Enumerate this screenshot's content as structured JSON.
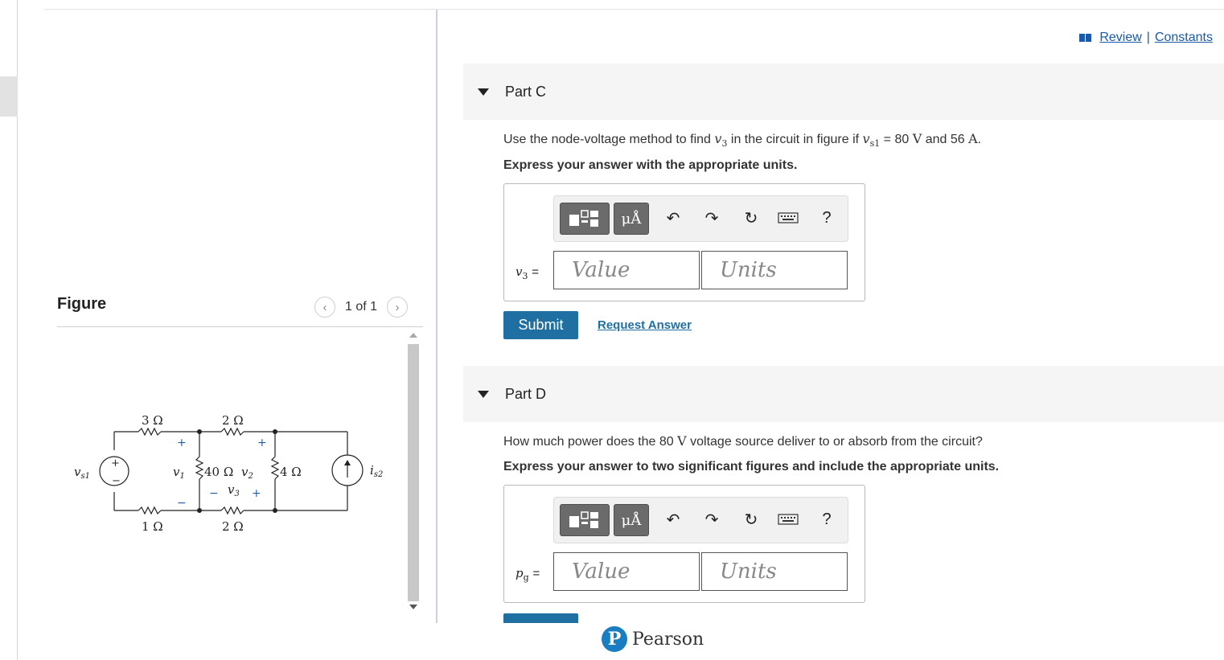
{
  "header": {
    "review_label": "Review",
    "separator": "|",
    "constants_label": "Constants"
  },
  "figure": {
    "title": "Figure",
    "pager_count": "1 of 1",
    "circuit_labels": {
      "r1": "3 Ω",
      "r2": "2 Ω",
      "r3": "40 Ω",
      "r4": "4 Ω",
      "r5": "1 Ω",
      "r6": "2 Ω",
      "v1": "v",
      "v1_sub": "1",
      "v2": "v",
      "v2_sub": "2",
      "v3": "v",
      "v3_sub": "3",
      "vs1": "v",
      "vs1_sub": "s1",
      "is2": "i",
      "is2_sub": "s2"
    }
  },
  "parts": [
    {
      "label": "Part C",
      "question_a": "Use the node-voltage method to find ",
      "question_var": "v",
      "question_var_sub": "3",
      "question_b": " in the circuit in figure if ",
      "question_var2": "v",
      "question_var2_sub": "s1",
      "question_c": " = 80 ",
      "question_unit1": "V",
      "question_d": " and 56 ",
      "question_unit2": "A",
      "question_e": ".",
      "instruction": "Express your answer with the appropriate units.",
      "var_label": "v",
      "var_sub": "3",
      "value_placeholder": "Value",
      "units_placeholder": "Units",
      "submit_label": "Submit",
      "request_label": "Request Answer"
    },
    {
      "label": "Part D",
      "question_a": "How much power does the 80 ",
      "question_unit1": "V",
      "question_b": " voltage source deliver to or absorb from the circuit?",
      "instruction": "Express your answer to two significant figures and include the appropriate units.",
      "var_label": "p",
      "var_sub": "g",
      "value_placeholder": "Value",
      "units_placeholder": "Units"
    }
  ],
  "toolbar": {
    "units_label": "μÅ",
    "help_label": "?"
  },
  "footer": {
    "brand": "Pearson",
    "brand_letter": "P"
  },
  "colors": {
    "link": "#1a5aa6",
    "submit": "#1f6fa3",
    "pearson_blue": "#1a7dc2"
  }
}
